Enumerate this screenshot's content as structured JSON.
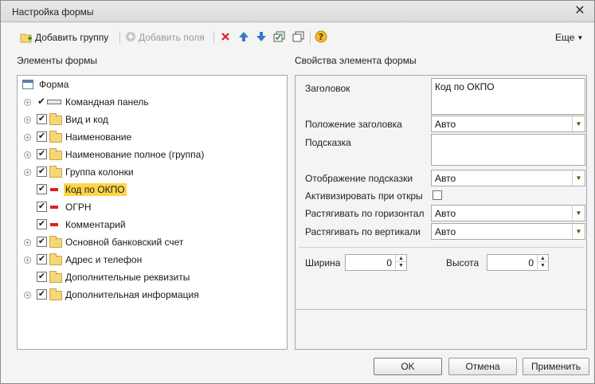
{
  "window": {
    "title": "Настройка формы"
  },
  "toolbar": {
    "add_group": "Добавить группу",
    "add_fields": "Добавить поля",
    "more": "Еще"
  },
  "left": {
    "heading": "Элементы формы",
    "root": "Форма",
    "items": [
      {
        "label": "Командная панель"
      },
      {
        "label": "Вид и код"
      },
      {
        "label": "Наименование"
      },
      {
        "label": "Наименование полное (группа)"
      },
      {
        "label": "Группа колонки"
      },
      {
        "label": "Код по ОКПО"
      },
      {
        "label": "ОГРН"
      },
      {
        "label": "Комментарий"
      },
      {
        "label": "Основной банковский счет"
      },
      {
        "label": "Адрес и телефон"
      },
      {
        "label": "Дополнительные реквизиты"
      },
      {
        "label": "Дополнительная информация"
      }
    ]
  },
  "right": {
    "heading": "Свойства элемента формы",
    "caption_label": "Заголовок",
    "caption_value": "Код по ОКПО",
    "caption_pos_label": "Положение заголовка",
    "caption_pos_value": "Авто",
    "hint_label": "Подсказка",
    "hint_value": "",
    "hint_display_label": "Отображение подсказки",
    "hint_display_value": "Авто",
    "activate_label": "Активизировать при откры",
    "stretch_h_label": "Растягивать по горизонтал",
    "stretch_h_value": "Авто",
    "stretch_v_label": "Растягивать по вертикали",
    "stretch_v_value": "Авто",
    "width_label": "Ширина",
    "width_value": "0",
    "height_label": "Высота",
    "height_value": "0"
  },
  "buttons": {
    "ok": "OK",
    "cancel": "Отмена",
    "apply": "Применить"
  },
  "colors": {
    "selection": "#ffd54a",
    "remove_icon": "#e02020",
    "move_icon": "#3a78c8"
  }
}
